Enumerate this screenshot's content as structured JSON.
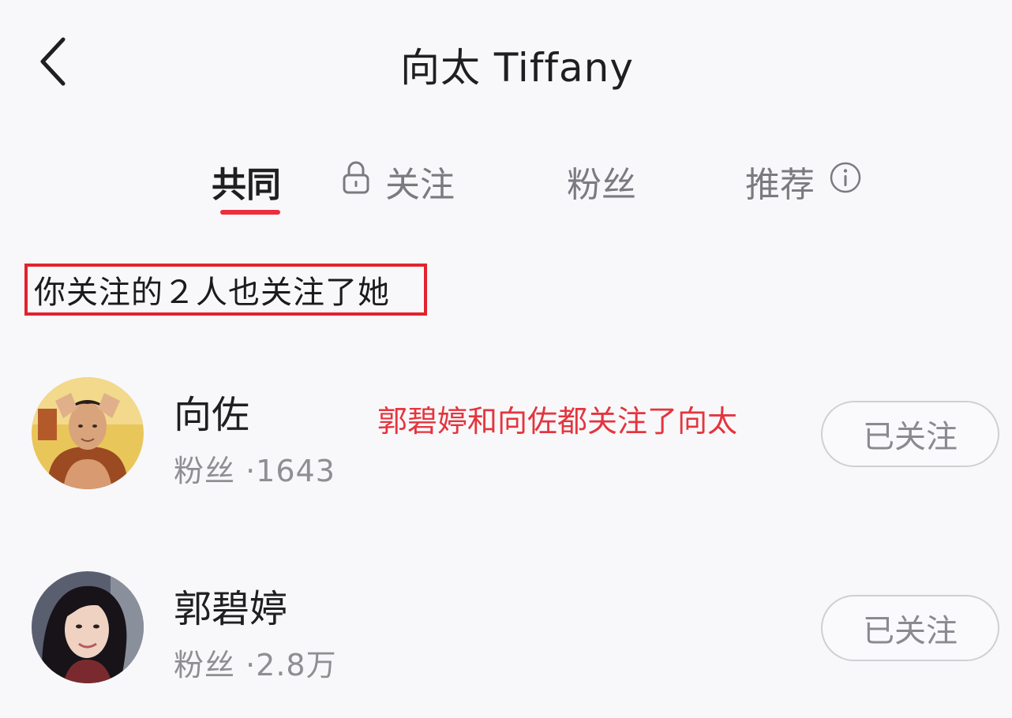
{
  "header": {
    "back_icon": "chevron-left-icon",
    "title": "向太 Tiffany"
  },
  "tabs": [
    {
      "label": "共同",
      "active": true,
      "icon": null
    },
    {
      "label": "关注",
      "active": false,
      "icon": "lock-icon"
    },
    {
      "label": "粉丝",
      "active": false,
      "icon": null
    },
    {
      "label": "推荐",
      "active": false,
      "icon": "info-icon"
    }
  ],
  "common_note": "你关注的２人也关注了她",
  "annotation": "郭碧婷和向佐都关注了向太",
  "users": [
    {
      "name": "向佐",
      "fans_label": "粉丝 ·1643",
      "button_label": "已关注"
    },
    {
      "name": "郭碧婷",
      "fans_label": "粉丝 ·2.8万",
      "button_label": "已关注"
    }
  ],
  "colors": {
    "accent_red": "#ec2e3d",
    "highlight_border": "#e1232d",
    "annotation_text": "#e4353e",
    "background": "#f8f8fa"
  }
}
